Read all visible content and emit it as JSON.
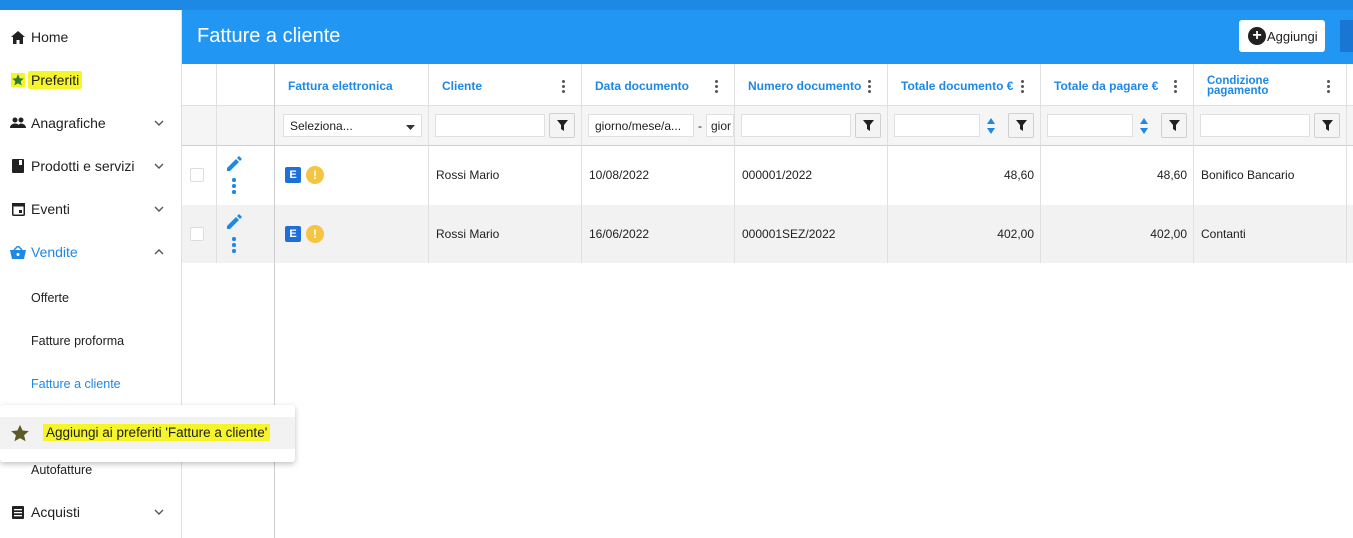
{
  "sidebar": {
    "items": [
      {
        "label": "Home",
        "icon": "home-icon"
      },
      {
        "label": "Preferiti",
        "icon": "star-icon"
      },
      {
        "label": "Anagrafiche",
        "icon": "people-icon"
      },
      {
        "label": "Prodotti e servizi",
        "icon": "book-icon"
      },
      {
        "label": "Eventi",
        "icon": "calendar-icon"
      },
      {
        "label": "Vendite",
        "icon": "basket-icon"
      },
      {
        "label": "Acquisti",
        "icon": "list-icon"
      }
    ],
    "vendite_sub": [
      "Offerte",
      "Fatture proforma",
      "Fatture a cliente",
      "Autofatture"
    ]
  },
  "popup": {
    "label": "Aggiungi ai preferiti 'Fatture a cliente'"
  },
  "header": {
    "title": "Fatture a cliente",
    "add_label": "Aggiungi"
  },
  "columns": [
    "Fattura elettronica",
    "Cliente",
    "Data documento",
    "Numero documento",
    "Totale documento €",
    "Totale da pagare €",
    "Condizione pagamento"
  ],
  "filters": {
    "fattura_select": "Seleziona...",
    "date_from_placeholder": "giorno/mese/a...",
    "date_separator": "-",
    "date_to_placeholder": "gior"
  },
  "rows": [
    {
      "badge": "E",
      "cliente": "Rossi Mario",
      "data": "10/08/2022",
      "numero": "000001/2022",
      "totale": "48,60",
      "da_pagare": "48,60",
      "condizione": "Bonifico Bancario"
    },
    {
      "badge": "E",
      "cliente": "Rossi Mario",
      "data": "16/06/2022",
      "numero": "000001SEZ/2022",
      "totale": "402,00",
      "da_pagare": "402,00",
      "condizione": "Contanti"
    }
  ],
  "colors": {
    "primary": "#2196f3",
    "highlight": "#f5f52a",
    "accent_text": "#1e88e5"
  }
}
